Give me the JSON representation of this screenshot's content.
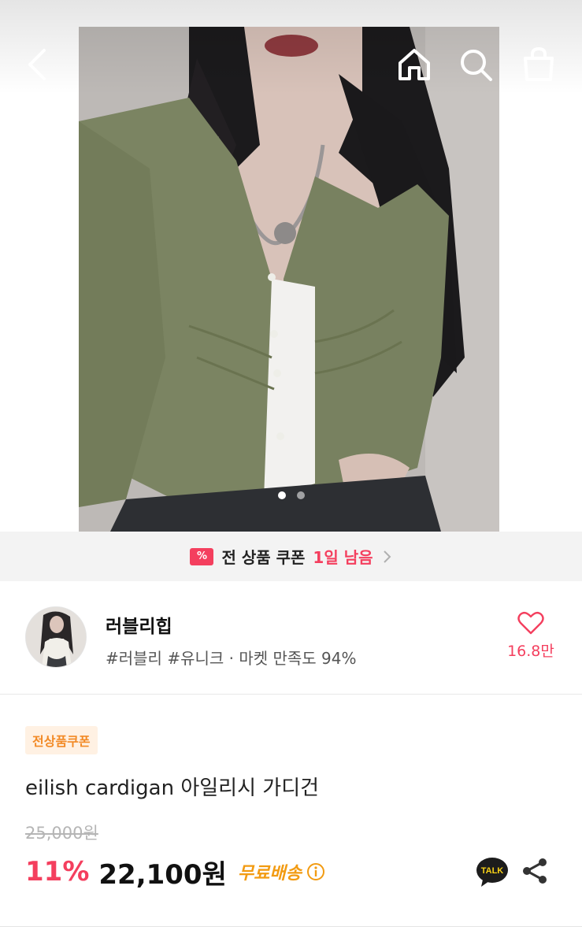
{
  "header": {
    "icons": [
      "back-arrow-icon",
      "home-icon",
      "search-icon",
      "shopping-bag-icon"
    ]
  },
  "carousel": {
    "total_slides": 2,
    "active_slide": 1
  },
  "coupon_banner": {
    "chip_symbol": "%",
    "text": "전 상품 쿠폰",
    "days_left": "1일 남음"
  },
  "seller": {
    "name": "러블리힙",
    "description": "#러블리 #유니크 · 마켓 만족도 94%",
    "like_count": "16.8만"
  },
  "product": {
    "badge": "전상품쿠폰",
    "title": "eilish cardigan 아일리시 가디건",
    "original_price": "25,000원",
    "discount": "11%",
    "price": "22,100원",
    "shipping": "무료배송",
    "talk_label": "TALK"
  },
  "colors": {
    "accent": "#f43f5e",
    "shipping": "#f29b12",
    "badge_bg": "#fff1e3",
    "badge_text": "#f28a26",
    "cardigan": "#7b8462"
  }
}
